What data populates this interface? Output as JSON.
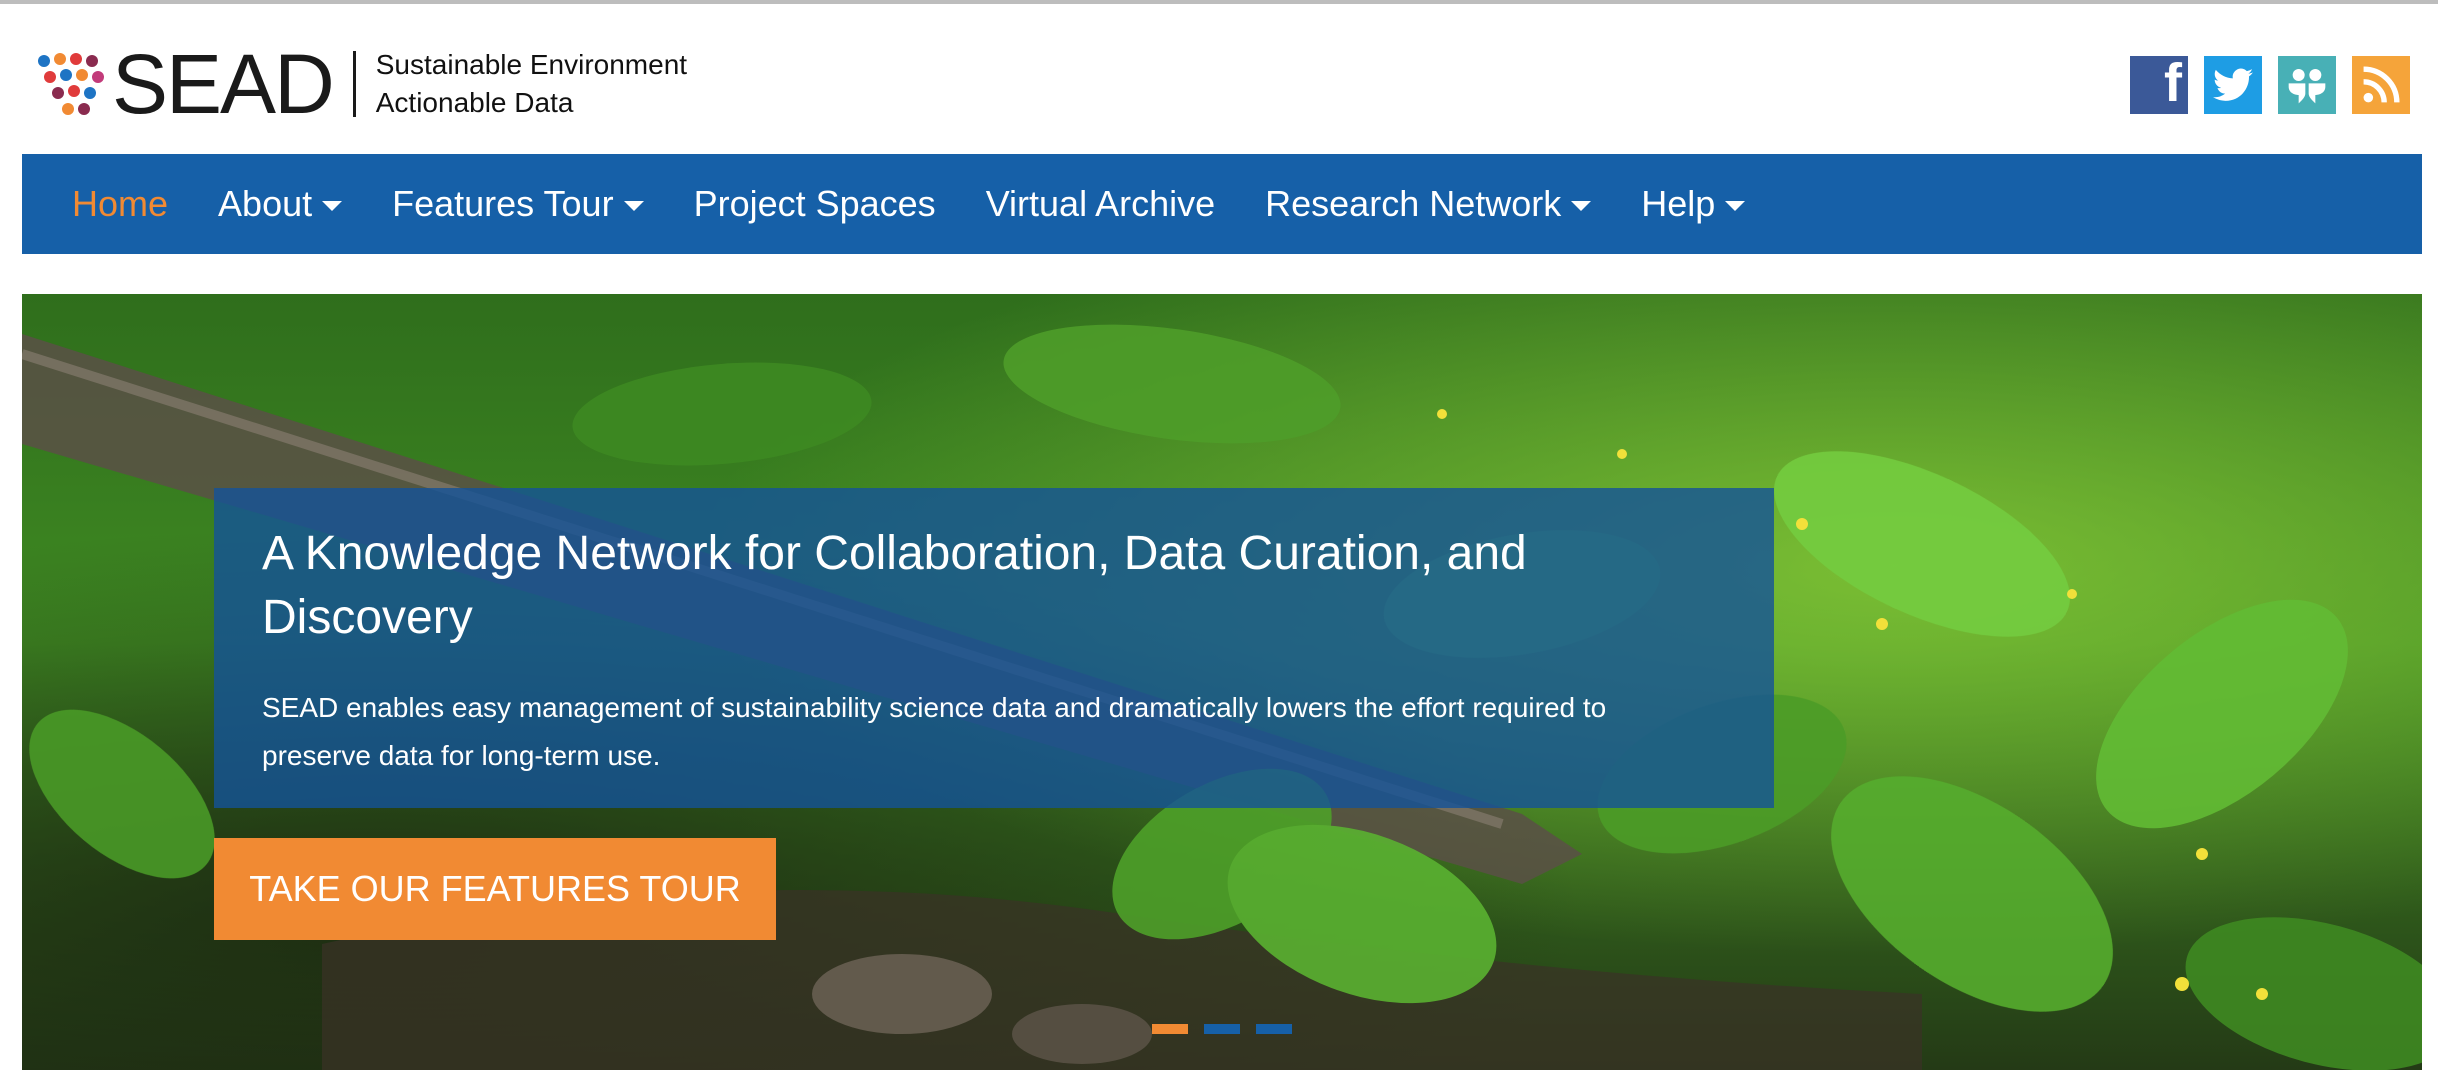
{
  "brand": {
    "name": "SEAD",
    "tagline_line1": "Sustainable Environment",
    "tagline_line2": "Actionable Data"
  },
  "social": [
    {
      "name": "facebook-icon",
      "glyph": "f",
      "color": "#3b5998"
    },
    {
      "name": "twitter-icon",
      "color": "#1e9de4"
    },
    {
      "name": "slideshare-icon",
      "color": "#48b0b6"
    },
    {
      "name": "rss-icon",
      "color": "#f5a43a"
    }
  ],
  "nav": {
    "items": [
      {
        "label": "Home",
        "active": true,
        "dropdown": false
      },
      {
        "label": "About",
        "active": false,
        "dropdown": true
      },
      {
        "label": "Features Tour",
        "active": false,
        "dropdown": true
      },
      {
        "label": "Project Spaces",
        "active": false,
        "dropdown": false
      },
      {
        "label": "Virtual Archive",
        "active": false,
        "dropdown": false
      },
      {
        "label": "Research Network",
        "active": false,
        "dropdown": true
      },
      {
        "label": "Help",
        "active": false,
        "dropdown": true
      }
    ]
  },
  "hero": {
    "title": "A Knowledge Network for Collaboration, Data Curation, and Discovery",
    "text": "SEAD enables easy management of sustainability science data and dramatically lowers the effort required to preserve data for long-term use.",
    "cta_label": "TAKE OUR FEATURES TOUR",
    "slides_count": 3,
    "active_slide": 1
  },
  "colors": {
    "nav_bg": "#1660a8",
    "accent": "#f18a33",
    "caption_bg": "rgba(20, 82, 152, 0.80)"
  }
}
